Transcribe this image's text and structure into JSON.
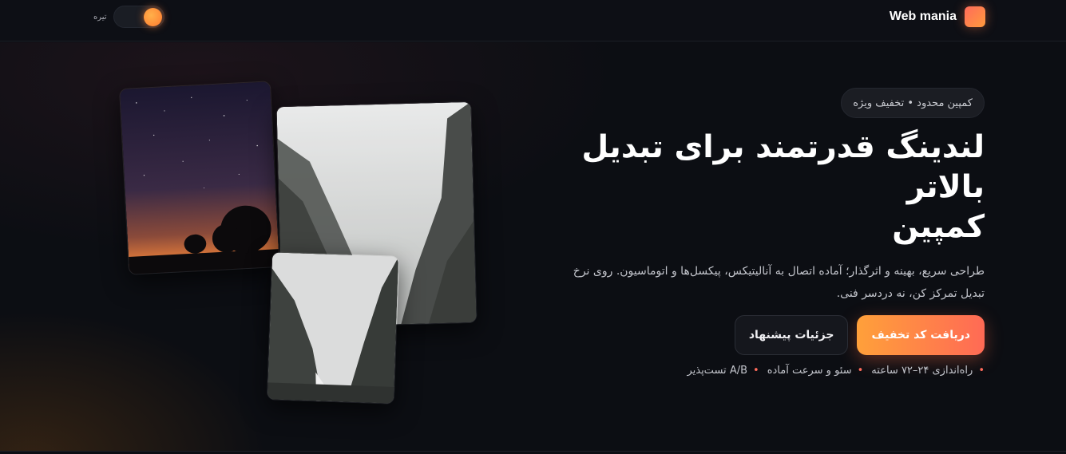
{
  "header": {
    "brand_name": "Web mania",
    "theme_label": "تیره"
  },
  "hero": {
    "badge": "کمپین محدود • تخفیف ویژه",
    "title_line1": "لندینگ قدرتمند برای تبدیل بالاتر",
    "title_line2": "کمپین",
    "subtitle_line1": "طراحی سریع، بهینه و اثرگذار؛ آماده اتصال به آنالیتیکس، پیکسل‌ها و اتوماسیون. روی نرخ",
    "subtitle_line2": "تبدیل تمرکز کن، نه دردسر فنی.",
    "primary_cta": "دریافت کد تخفیف",
    "secondary_cta": "جزئیات پیشنهاد",
    "features": [
      "راه‌اندازی ۲۴–۷۲ ساعته",
      "سئو و سرعت آماده",
      "A/B تست‌پذیر"
    ]
  },
  "colors": {
    "accent_start": "#ffa03a",
    "accent_end": "#ff6a55",
    "background": "#0c0e13"
  }
}
